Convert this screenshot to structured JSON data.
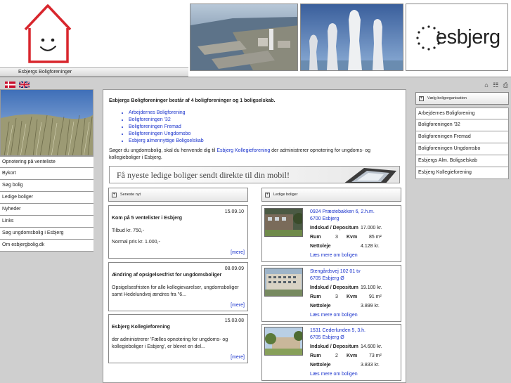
{
  "header": {
    "site_name": "Esbjergs Boligforeninger",
    "city_logo_text": "esbjerg"
  },
  "tool_icons": [
    "home-icon",
    "sitemap-icon",
    "print-icon"
  ],
  "left_nav": [
    "Opnotering på venteliste",
    "Bykort",
    "Søg bolig",
    "Ledige boliger",
    "Nyheder",
    "Links",
    "Søg ungdomsbolig i Esbjerg",
    "Om esbjergbolig.dk"
  ],
  "main": {
    "heading": "Esbjergs Boligforeninger består af 4 boligforeninger og 1 boligselskab.",
    "orgs": [
      "Arbejdernes Boligforening",
      "Boligforeningen '32",
      "Boligforeningen Fremad",
      "Boligforeningen Ungdomsbo",
      "Esbjerg almennyttige Boligselskab"
    ],
    "intro_pre": "Søger du ungdomsbolig, skal du henvende dig til ",
    "intro_link": "Esbjerg Kollegieforening",
    "intro_post": " der administrerer opnotering for ungdoms- og kollegieboliger i Esbjerg.",
    "banner_text": "Få nyeste ledige boliger sendt direkte til din mobil!",
    "news_header": "Seneste nyt",
    "flats_header": "Ledige boliger"
  },
  "news": [
    {
      "date": "15.09.10",
      "title": "Kom på 5 ventelister i Esbjerg",
      "body1": "Tilbud kr. 750,-",
      "body2": "Normal pris kr. 1.000,-",
      "more": "[mere]"
    },
    {
      "date": "08.09.09",
      "title": "Ændring af opsigelsesfrist for ungdomsboliger",
      "body1": "Opsigelsesfristen for alle kollegievarelser, ungdomsboliger samt Hedelundvej ændres fra \"6...",
      "body2": "",
      "more": "[mere]"
    },
    {
      "date": "15.03.08",
      "title": "Esbjerg Kollegieforening",
      "body1": "der administrerer 'Fælles opnotering for ungdoms- og kollegieboliger i Esbjerg', er blevet en del...",
      "body2": "",
      "more": "[mere]"
    }
  ],
  "flats": [
    {
      "addr1": "0924 Præstebakken 6, 2.h.m.",
      "addr2": "6700 Esbjerg",
      "deposit_label": "Indskud / Depositum",
      "deposit": "17.000 kr.",
      "rooms_label": "Rum",
      "rooms": "3",
      "area_label": "Kvm",
      "area": "85 m²",
      "rent_label": "Nettoleje",
      "rent": "4.128 kr.",
      "more": "Læs mere om boligen"
    },
    {
      "addr1": "Stengårdsvej 102 01 tv",
      "addr2": "6705 Esbjerg Ø",
      "deposit_label": "Indskud / Depositum",
      "deposit": "19.100 kr.",
      "rooms_label": "Rum",
      "rooms": "3",
      "area_label": "Kvm",
      "area": "91 m²",
      "rent_label": "Nettoleje",
      "rent": "3.899 kr.",
      "more": "Læs mere om boligen"
    },
    {
      "addr1": "1531 Cederlunden 5, 3.h.",
      "addr2": "6705 Esbjerg Ø",
      "deposit_label": "Indskud / Depositum",
      "deposit": "14.600 kr.",
      "rooms_label": "Rum",
      "rooms": "2",
      "area_label": "Kvm",
      "area": "73 m²",
      "rent_label": "Nettoleje",
      "rent": "3.833 kr.",
      "more": "Læs mere om boligen"
    }
  ],
  "right_nav": {
    "header": "Vælg boligorganisation",
    "items": [
      "Arbejdernes Boligforening",
      "Boligforeningen '32",
      "Boligforeningen Fremad",
      "Boligforeningen Ungdomsbo",
      "Esbjergs Alm. Boligselskab",
      "Esbjerg Kollegieforening"
    ]
  }
}
